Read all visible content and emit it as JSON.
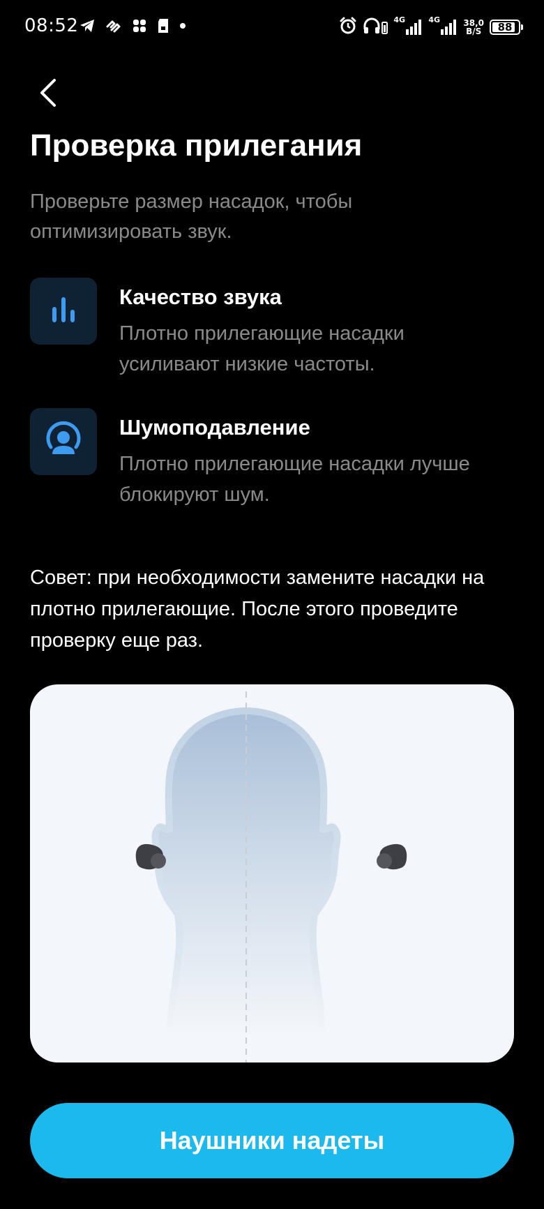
{
  "status_bar": {
    "time": "08:52",
    "network_1": "4G",
    "network_2": "4G",
    "speed_value": "38,0",
    "speed_unit": "B/S",
    "battery": "88",
    "battery_level": 0.88,
    "icons_left": [
      "telegram-icon",
      "wave-app-icon",
      "hash-app-icon",
      "sd-card-icon",
      "dot-icon"
    ],
    "icons_right": [
      "alarm-icon",
      "headphones-battery-icon",
      "signal-icon",
      "signal-icon",
      "battery-icon"
    ]
  },
  "header": {
    "back_icon": "chevron-left-icon",
    "title": "Проверка прилегания",
    "subtitle": "Проверьте размер насадок, чтобы оптимизировать звук."
  },
  "features": [
    {
      "icon": "equalizer-bars-icon",
      "title": "Качество звука",
      "description": "Плотно прилегающие насадки усиливают низкие частоты."
    },
    {
      "icon": "person-noise-cancel-icon",
      "title": "Шумоподавление",
      "description": "Плотно прилегающие насадки лучше блокируют шум."
    }
  ],
  "tip": "Совет: при необходимости замените насадки на плотно прилегающие. После этого проведите проверку еще раз.",
  "illustration": {
    "icon": "head-with-earbuds-illustration"
  },
  "primary_button": {
    "label": "Наушники надеты"
  },
  "colors": {
    "background": "#000000",
    "accent": "#1bb9ee",
    "icon_blue": "#3d9cf0",
    "icon_box": "#0e2233",
    "secondary_text": "#8a8a8a",
    "card_bg": "#f3f6fa"
  }
}
